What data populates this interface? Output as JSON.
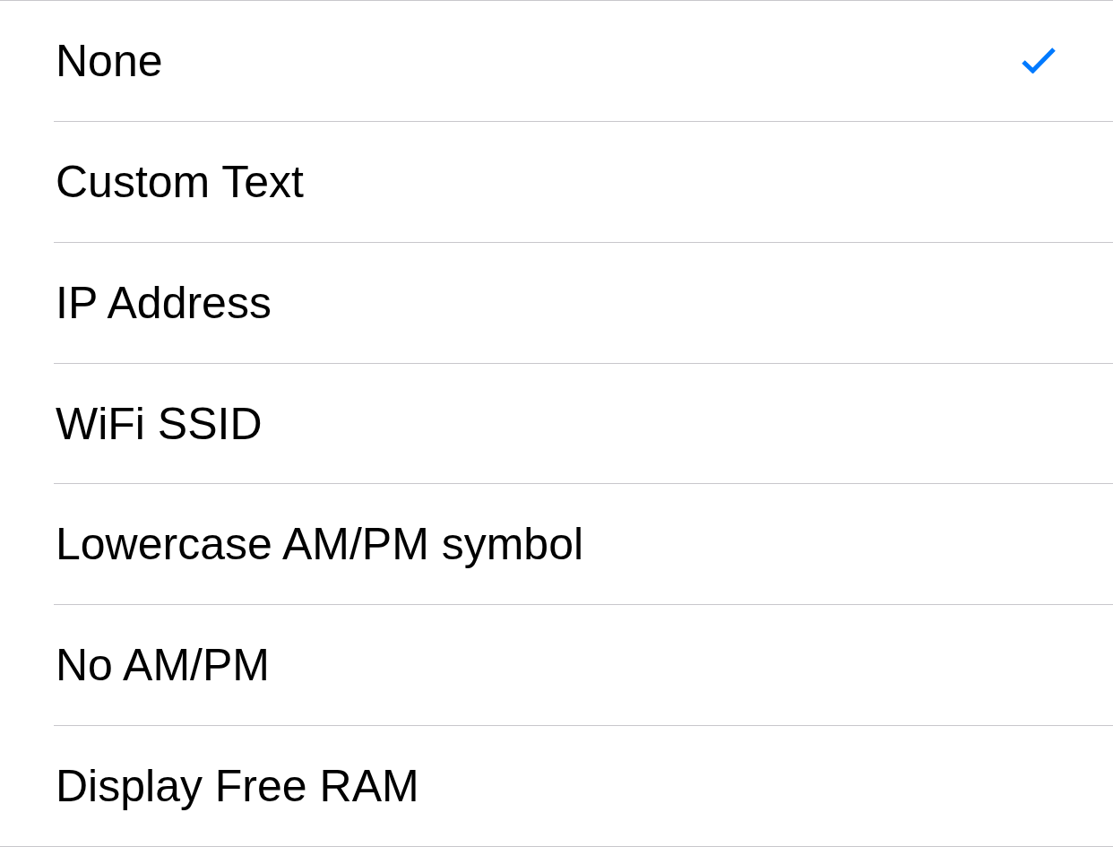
{
  "options": [
    {
      "label": "None",
      "selected": true
    },
    {
      "label": "Custom Text",
      "selected": false
    },
    {
      "label": "IP Address",
      "selected": false
    },
    {
      "label": "WiFi SSID",
      "selected": false
    },
    {
      "label": "Lowercase AM/PM symbol",
      "selected": false
    },
    {
      "label": "No AM/PM",
      "selected": false
    },
    {
      "label": "Display Free RAM",
      "selected": false
    }
  ]
}
